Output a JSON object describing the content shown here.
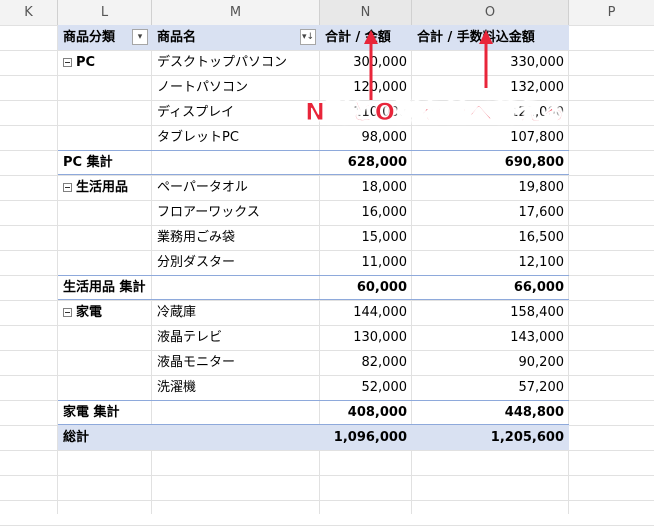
{
  "columns": [
    "K",
    "L",
    "M",
    "N",
    "O",
    "P"
  ],
  "header": {
    "category": "商品分類",
    "product": "商品名",
    "sum_amount": "合計 / 金額",
    "sum_amount_with_fee": "合計 / 手数料込金額"
  },
  "groups": [
    {
      "name": "PC",
      "items": [
        {
          "product": "デスクトップパソコン",
          "amount": "300,000",
          "amount_fee": "330,000"
        },
        {
          "product": "ノートパソコン",
          "amount": "120,000",
          "amount_fee": "132,000"
        },
        {
          "product": "ディスプレイ",
          "amount": "110,000",
          "amount_fee": "121,000"
        },
        {
          "product": "タブレットPC",
          "amount": "98,000",
          "amount_fee": "107,800"
        }
      ],
      "subtotal_label": "PC 集計",
      "subtotal_amount": "628,000",
      "subtotal_amount_fee": "690,800"
    },
    {
      "name": "生活用品",
      "items": [
        {
          "product": "ペーパータオル",
          "amount": "18,000",
          "amount_fee": "19,800"
        },
        {
          "product": "フロアーワックス",
          "amount": "16,000",
          "amount_fee": "17,600"
        },
        {
          "product": "業務用ごみ袋",
          "amount": "15,000",
          "amount_fee": "16,500"
        },
        {
          "product": "分別ダスター",
          "amount": "11,000",
          "amount_fee": "12,100"
        }
      ],
      "subtotal_label": "生活用品 集計",
      "subtotal_amount": "60,000",
      "subtotal_amount_fee": "66,000"
    },
    {
      "name": "家電",
      "items": [
        {
          "product": "冷蔵庫",
          "amount": "144,000",
          "amount_fee": "158,400"
        },
        {
          "product": "液晶テレビ",
          "amount": "130,000",
          "amount_fee": "143,000"
        },
        {
          "product": "液晶モニター",
          "amount": "82,000",
          "amount_fee": "90,200"
        },
        {
          "product": "洗濯機",
          "amount": "52,000",
          "amount_fee": "57,200"
        }
      ],
      "subtotal_label": "家電 集計",
      "subtotal_amount": "408,000",
      "subtotal_amount_fee": "448,800"
    }
  ],
  "grand_total": {
    "label": "総計",
    "amount": "1,096,000",
    "amount_fee": "1,205,600"
  },
  "annotation": "N列とO列を並べ替える",
  "colors": {
    "annotation": "#e8253a",
    "header_fill": "#d9e1f2"
  }
}
